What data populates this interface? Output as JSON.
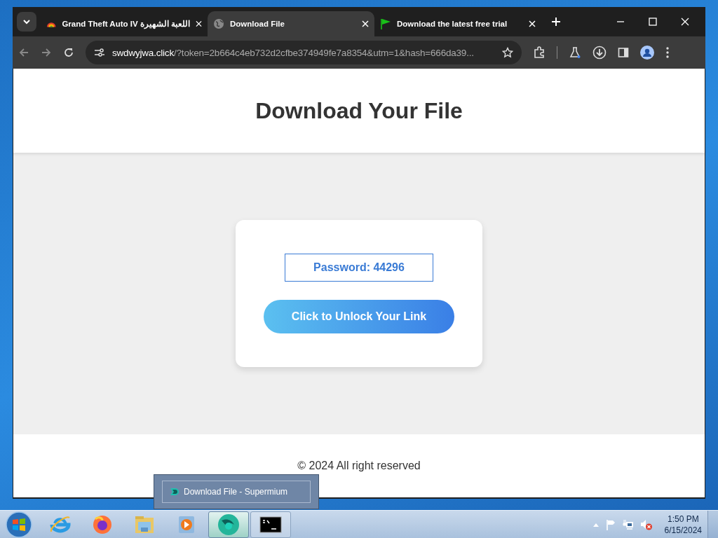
{
  "browser": {
    "tabs": [
      {
        "title": "Grand Theft Auto IV اللعبة الشهيرة",
        "kind": "game",
        "selected": false
      },
      {
        "title": "Download File",
        "kind": "globe",
        "selected": true
      },
      {
        "title": "Download the latest free trial",
        "kind": "flag",
        "selected": false
      }
    ],
    "address": {
      "domain": "swdwyjwa.click",
      "path": "/?token=2b664c4eb732d2cfbe374949fe7a8354&utm=1&hash=666da39..."
    }
  },
  "page": {
    "heading": "Download Your File",
    "password": "Password: 44296",
    "button": "Click to Unlock Your Link",
    "footer": "© 2024 All right reserved"
  },
  "taskbar": {
    "apps": [
      {
        "kind": "ie",
        "selected": false,
        "running": false
      },
      {
        "kind": "firefox",
        "selected": false,
        "running": false
      },
      {
        "kind": "explorer",
        "selected": false,
        "running": false
      },
      {
        "kind": "media",
        "selected": false,
        "running": false
      },
      {
        "kind": "browser",
        "selected": true,
        "running": true
      },
      {
        "kind": "console",
        "selected": false,
        "running": true
      }
    ],
    "preview": {
      "title": "Download File - Supermium"
    },
    "clock": {
      "time": "1:50 PM",
      "date": "6/15/2024"
    }
  }
}
